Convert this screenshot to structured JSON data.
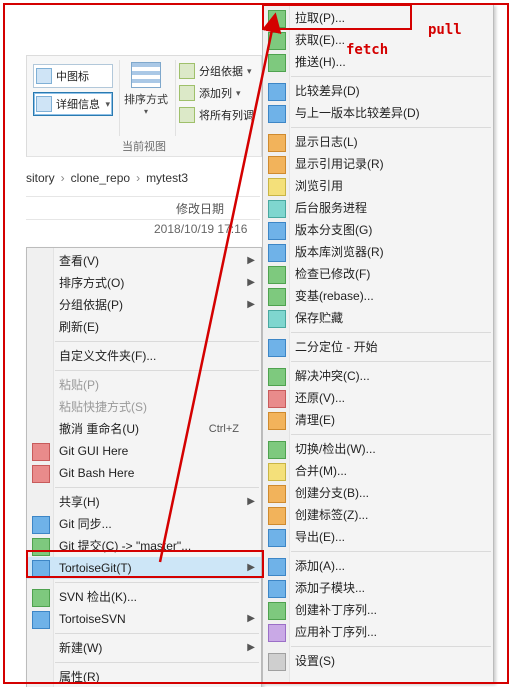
{
  "annotations": {
    "pull_label": "pull",
    "fetch_label": "fetch"
  },
  "ribbon": {
    "view_medium": "中图标",
    "view_details": "详细信息",
    "sort_label": "排序方式",
    "group_by": "分组依据",
    "add_col": "添加列",
    "fit_cols": "将所有列调",
    "footer": "当前视图"
  },
  "breadcrumbs": [
    "sitory",
    "clone_repo",
    "mytest3"
  ],
  "header": {
    "date_col": "修改日期"
  },
  "list": {
    "row0_date": "2018/10/19 17:16"
  },
  "context_menu": [
    {
      "label": "查看(V)",
      "submenu": true
    },
    {
      "label": "排序方式(O)",
      "submenu": true
    },
    {
      "label": "分组依据(P)",
      "submenu": true
    },
    {
      "label": "刷新(E)"
    },
    {
      "sep": true
    },
    {
      "label": "自定义文件夹(F)..."
    },
    {
      "sep": true
    },
    {
      "label": "粘贴(P)",
      "disabled": true
    },
    {
      "label": "粘贴快捷方式(S)",
      "disabled": true
    },
    {
      "label": "撤消 重命名(U)",
      "shortcut": "Ctrl+Z"
    },
    {
      "label": "Git GUI Here",
      "icon": "ic-red"
    },
    {
      "label": "Git Bash Here",
      "icon": "ic-red"
    },
    {
      "sep": true
    },
    {
      "label": "共享(H)",
      "submenu": true
    },
    {
      "label": "Git 同步...",
      "icon": "ic-blue"
    },
    {
      "label": "Git 提交(C) -> \"master\"...",
      "icon": "ic-green"
    },
    {
      "label": "TortoiseGit(T)",
      "icon": "ic-blue",
      "submenu": true,
      "hover": true
    },
    {
      "sep": true
    },
    {
      "label": "SVN 检出(K)...",
      "icon": "ic-green"
    },
    {
      "label": "TortoiseSVN",
      "icon": "ic-blue",
      "submenu": true
    },
    {
      "sep": true
    },
    {
      "label": "新建(W)",
      "submenu": true
    },
    {
      "sep": true
    },
    {
      "label": "属性(R)"
    }
  ],
  "tortoise_submenu": [
    {
      "label": "拉取(P)...",
      "icon": "ic-green"
    },
    {
      "label": "获取(E)...",
      "icon": "ic-green"
    },
    {
      "label": "推送(H)...",
      "icon": "ic-green"
    },
    {
      "sep": true
    },
    {
      "label": "比较差异(D)",
      "icon": "ic-blue"
    },
    {
      "label": "与上一版本比较差异(D)",
      "icon": "ic-blue"
    },
    {
      "sep": true
    },
    {
      "label": "显示日志(L)",
      "icon": "ic-orange"
    },
    {
      "label": "显示引用记录(R)",
      "icon": "ic-orange"
    },
    {
      "label": "浏览引用",
      "icon": "ic-yellow"
    },
    {
      "label": "后台服务进程",
      "icon": "ic-teal"
    },
    {
      "label": "版本分支图(G)",
      "icon": "ic-blue"
    },
    {
      "label": "版本库浏览器(R)",
      "icon": "ic-blue"
    },
    {
      "label": "检查已修改(F)",
      "icon": "ic-green"
    },
    {
      "label": "变基(rebase)...",
      "icon": "ic-green"
    },
    {
      "label": "保存贮藏",
      "icon": "ic-teal"
    },
    {
      "sep": true
    },
    {
      "label": "二分定位 - 开始",
      "icon": "ic-blue"
    },
    {
      "sep": true
    },
    {
      "label": "解决冲突(C)...",
      "icon": "ic-green"
    },
    {
      "label": "还原(V)...",
      "icon": "ic-red"
    },
    {
      "label": "清理(E)",
      "icon": "ic-orange"
    },
    {
      "sep": true
    },
    {
      "label": "切换/检出(W)...",
      "icon": "ic-green"
    },
    {
      "label": "合并(M)...",
      "icon": "ic-yellow"
    },
    {
      "label": "创建分支(B)...",
      "icon": "ic-orange"
    },
    {
      "label": "创建标签(Z)...",
      "icon": "ic-orange"
    },
    {
      "label": "导出(E)...",
      "icon": "ic-blue"
    },
    {
      "sep": true
    },
    {
      "label": "添加(A)...",
      "icon": "ic-blue"
    },
    {
      "label": "添加子模块...",
      "icon": "ic-blue"
    },
    {
      "label": "创建补丁序列...",
      "icon": "ic-green"
    },
    {
      "label": "应用补丁序列...",
      "icon": "ic-purple"
    },
    {
      "sep": true
    },
    {
      "label": "设置(S)",
      "icon": "ic-grey"
    }
  ]
}
